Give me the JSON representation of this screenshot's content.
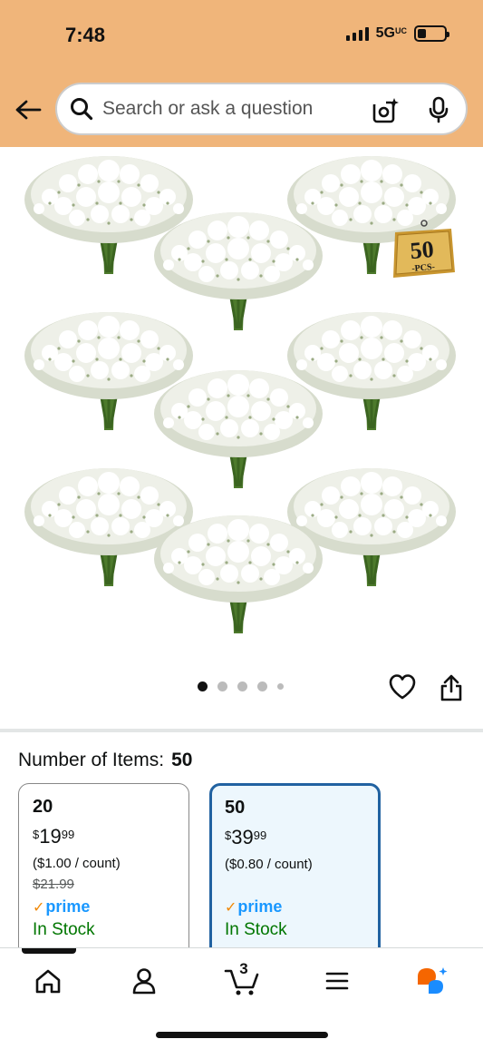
{
  "status_bar": {
    "time": "7:48",
    "network": "5G",
    "network_superscript": "UC"
  },
  "search": {
    "placeholder": "Search or ask a question"
  },
  "product_image": {
    "badge_number": "50",
    "badge_text": "-PCS-"
  },
  "carousel": {
    "total_dots": 5,
    "active_index": 0
  },
  "variation": {
    "label": "Number of Items:",
    "selected_value": "50",
    "options": [
      {
        "qty": "20",
        "currency": "$",
        "price_whole": "19",
        "price_fraction": "99",
        "unit_price": "($1.00 / count)",
        "list_price": "$21.99",
        "prime": "prime",
        "stock": "In Stock",
        "selected": false
      },
      {
        "qty": "50",
        "currency": "$",
        "price_whole": "39",
        "price_fraction": "99",
        "unit_price": "($0.80 / count)",
        "list_price": "",
        "prime": "prime",
        "stock": "In Stock",
        "selected": true
      }
    ]
  },
  "bottom_nav": {
    "cart_count": "3",
    "items": [
      "home-icon",
      "account-icon",
      "cart-icon",
      "menu-icon",
      "rufus-icon"
    ]
  },
  "colors": {
    "header_bg": "#f0b57a",
    "selected_border": "#2162a1",
    "selected_bg": "#edf7fd",
    "prime_blue": "#1a98ff",
    "in_stock_green": "#007600"
  }
}
